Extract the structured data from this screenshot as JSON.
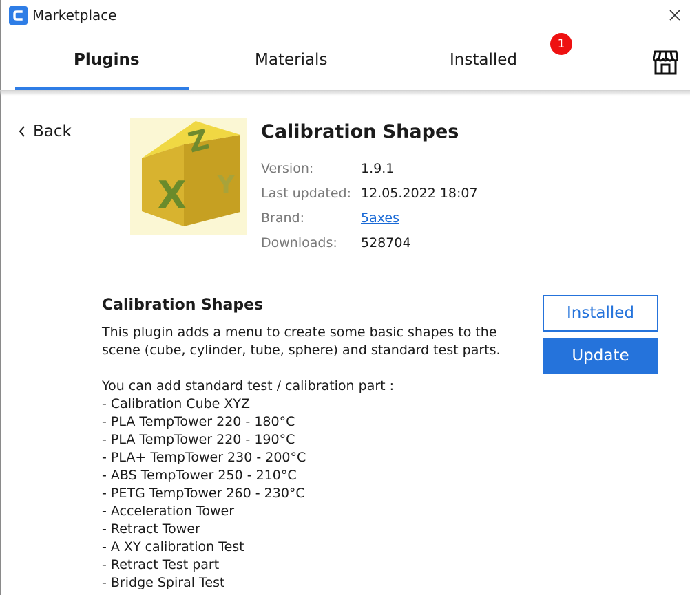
{
  "window": {
    "title": "Marketplace"
  },
  "tabs": [
    {
      "label": "Plugins"
    },
    {
      "label": "Materials"
    },
    {
      "label": "Installed"
    }
  ],
  "notification_badge": "1",
  "back_label": "Back",
  "plugin": {
    "name": "Calibration Shapes",
    "meta": [
      {
        "key": "Version:",
        "value": "1.9.1"
      },
      {
        "key": "Last updated:",
        "value": "12.05.2022 18:07"
      },
      {
        "key": "Brand:",
        "value": "5axes"
      },
      {
        "key": "Downloads:",
        "value": "528704"
      }
    ],
    "image_letters": {
      "top": "Z",
      "front": "X",
      "side": "Y"
    }
  },
  "description": {
    "title": "Calibration Shapes",
    "lines": [
      "This plugin adds a menu to create some basic shapes to the",
      "scene (cube, cylinder, tube, sphere) and standard test parts.",
      "",
      "You can add standard test / calibration part :",
      "- Calibration Cube XYZ",
      "- PLA TempTower 220 - 180°C",
      "- PLA TempTower 220 - 190°C",
      "- PLA+ TempTower 230 - 200°C",
      "- ABS TempTower 250 - 210°C",
      "- PETG TempTower 260 - 230°C",
      "- Acceleration Tower",
      "- Retract Tower",
      "- A XY calibration Test",
      "- Retract Test part",
      "- Bridge Spiral Test"
    ]
  },
  "buttons": {
    "installed": "Installed",
    "update": "Update"
  },
  "colors": {
    "accent": "#2573db",
    "badge": "#ee1111",
    "cube": "#e6c73a"
  }
}
